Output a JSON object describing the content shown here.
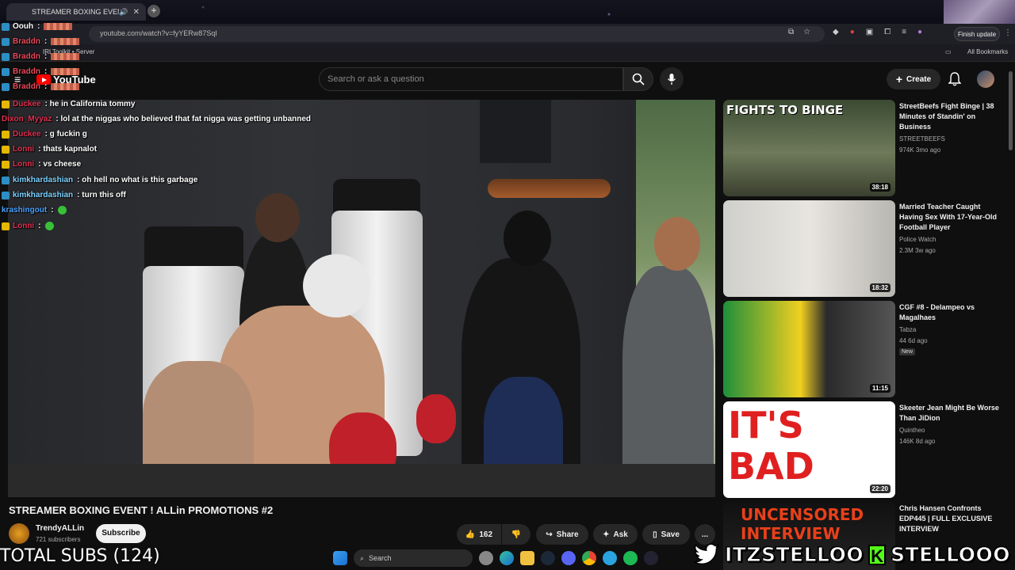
{
  "browser": {
    "tab_title": "STREAMER BOXING EVENT",
    "url": "youtube.com/watch?v=fyYERw87SqI",
    "finish_update": "Finish update",
    "bookmark_left": "IRLToolkit • Server",
    "bookmark_right": "All Bookmarks"
  },
  "youtube": {
    "logo": "YouTube",
    "search_placeholder": "Search or ask a question",
    "create": "Create"
  },
  "video": {
    "title": "STREAMER BOXING EVENT ! ALLin PROMOTIONS #2",
    "channel": "TrendyALLin",
    "subs": "721 subscribers",
    "subscribe": "Subscribe",
    "likes": "162",
    "share": "Share",
    "ask": "Ask",
    "save": "Save",
    "more": "..."
  },
  "chat": [
    {
      "user": "Oouh",
      "text": ":",
      "color": "#ffffff",
      "badge": "blue",
      "redact": true
    },
    {
      "user": "Braddn",
      "text": ":",
      "color": "#e84a5a",
      "badge": "blue",
      "redact": true
    },
    {
      "user": "Braddn",
      "text": ":",
      "color": "#e84a5a",
      "badge": "blue",
      "redact": true
    },
    {
      "user": "Braddn",
      "text": ":",
      "color": "#e84a5a",
      "badge": "blue",
      "redact": true
    },
    {
      "user": "Braddn",
      "text": ":",
      "color": "#e84a5a",
      "badge": "blue",
      "redact": true
    },
    {
      "user": "Duckee",
      "text": ": he in California tommy",
      "color": "#e03050",
      "badge": "yellow"
    },
    {
      "user": "Dixon_Myyaz",
      "text": ": lol at the niggas who believed that fat nigga was getting unbanned",
      "color": "#e03050",
      "badge": "none"
    },
    {
      "user": "Duckee",
      "text": ": g fuckin g",
      "color": "#e03050",
      "badge": "yellow"
    },
    {
      "user": "Lonni",
      "text": ": thats kapnalot",
      "color": "#e03050",
      "badge": "yellow"
    },
    {
      "user": "Lonni",
      "text": ": vs cheese",
      "color": "#e03050",
      "badge": "yellow"
    },
    {
      "user": "kimkhardashian",
      "text": ": oh hell no what is this garbage",
      "color": "#7fd3ff",
      "badge": "blue"
    },
    {
      "user": "kimkhardashian",
      "text": ": turn this off",
      "color": "#7fd3ff",
      "badge": "blue"
    },
    {
      "user": "krashingout",
      "text": ":",
      "color": "#4aa3ff",
      "badge": "none",
      "emote": true
    },
    {
      "user": "Lonni",
      "text": ":",
      "color": "#e03050",
      "badge": "yellow",
      "emote": true
    }
  ],
  "recs": [
    {
      "title": "StreetBeefs Fight Binge | 38 Minutes of Standin' on Business",
      "channel": "STREETBEEFS",
      "meta": "974K  3mo ago",
      "duration": "38:18",
      "thumb_text": "FIGHTS TO BINGE",
      "thumb_color": "#5a6a4a"
    },
    {
      "title": "Married Teacher Caught Having Sex With 17-Year-Old Football Player",
      "channel": "Police Watch",
      "meta": "2.3M  3w ago",
      "duration": "18:32",
      "thumb_text": "",
      "thumb_color": "#b8b6b0"
    },
    {
      "title": "CGF #8 - Delampeo vs Magalhaes",
      "channel": "Tabza",
      "meta": "44  6d ago",
      "badge": "New",
      "duration": "11:15",
      "thumb_text": "",
      "thumb_color": "#2f7a3a"
    },
    {
      "title": "Skeeter Jean Might Be Worse Than JiDion",
      "channel": "Quintheo",
      "meta": "146K  8d ago",
      "duration": "22:20",
      "thumb_text": "IT'S BAD",
      "thumb_color": "#ffffff"
    },
    {
      "title": "Chris Hansen Confronts EDP445 | FULL EXCLUSIVE INTERVIEW",
      "channel": "",
      "meta": "",
      "duration": "",
      "thumb_text": "UNCENSORED INTERVIEW",
      "thumb_color": "#1a1a1a"
    }
  ],
  "overlay": {
    "total_subs": "TOTAL SUBS (124)",
    "twitter": "ITZSTELLOO",
    "kick": "K",
    "kick_name": "STELLOOO"
  },
  "taskbar": {
    "search": "Search"
  }
}
